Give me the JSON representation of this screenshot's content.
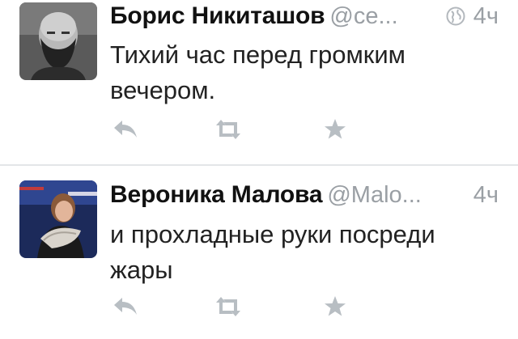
{
  "tweets": [
    {
      "name": "Борис Никиташов",
      "handle": "@ce...",
      "time": "4ч",
      "show_globe": true,
      "text": "Тихий час перед громким вечером.",
      "avatar": "man-with-beard-photo"
    },
    {
      "name": "Вероника Малова",
      "handle": "@Malo...",
      "time": "4ч",
      "show_globe": false,
      "text": "и прохладные руки посреди жары",
      "avatar": "woman-with-scarf-photo"
    }
  ],
  "actions": {
    "reply_icon": "reply-icon",
    "retweet_icon": "retweet-icon",
    "favorite_icon": "star-icon",
    "color": "#b8bec3"
  },
  "colors": {
    "name": "#111111",
    "handle": "#9a9fa4",
    "divider": "#e3e6e8"
  }
}
